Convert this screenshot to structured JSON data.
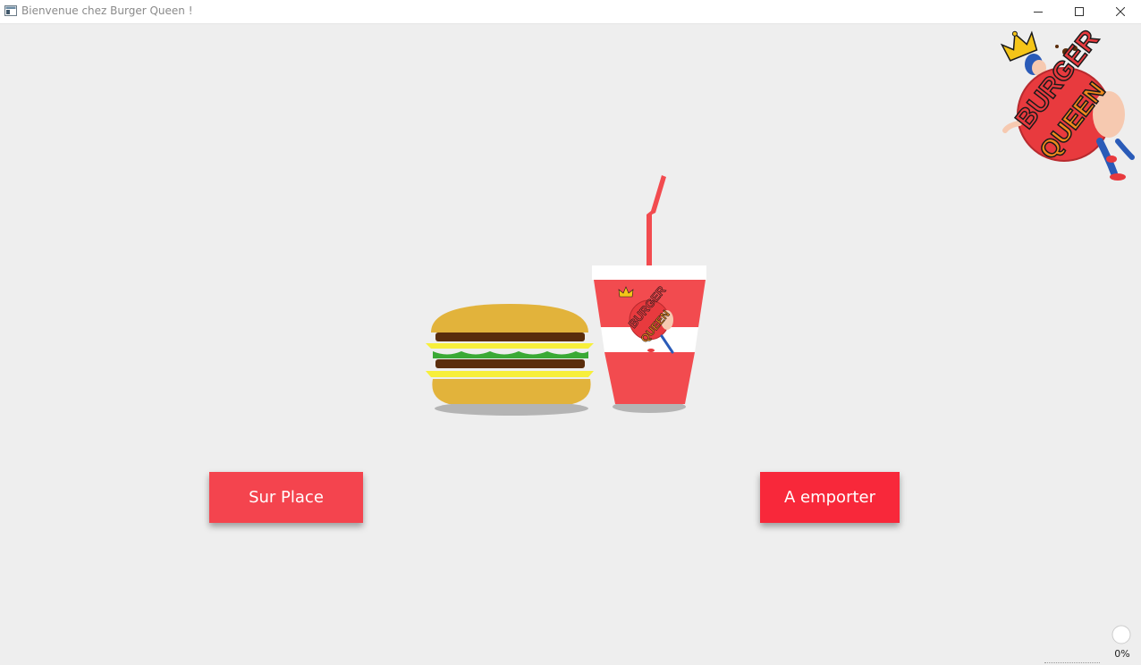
{
  "window": {
    "title": "Bienvenue chez Burger Queen !",
    "controls": [
      "minimize-icon",
      "maximize-icon",
      "close-icon"
    ]
  },
  "logo": {
    "line1": "BURGER",
    "line2": "QUEEN",
    "colors": {
      "red": "#e83a3e",
      "orange": "#f08a1c",
      "crown": "#f5c518",
      "skin": "#f6c9b0",
      "blue": "#2a5bb8"
    }
  },
  "illustration": {
    "cup_logo_line1": "BURGER",
    "cup_logo_line2": "QUEEN",
    "colors": {
      "bun": "#e2b33b",
      "patty": "#5a2d0c",
      "cheese": "#f7ef3b",
      "lettuce": "#3aa935",
      "cup": "#f24b4f",
      "straw": "#f24b4f",
      "shadow": "#b4b4b4"
    }
  },
  "buttons": {
    "sur_place": {
      "label": "Sur Place",
      "color": "#f4444e"
    },
    "a_emporter": {
      "label": "A emporter",
      "color": "#f8283a"
    }
  },
  "progress": {
    "label": "0%",
    "value": 0
  }
}
